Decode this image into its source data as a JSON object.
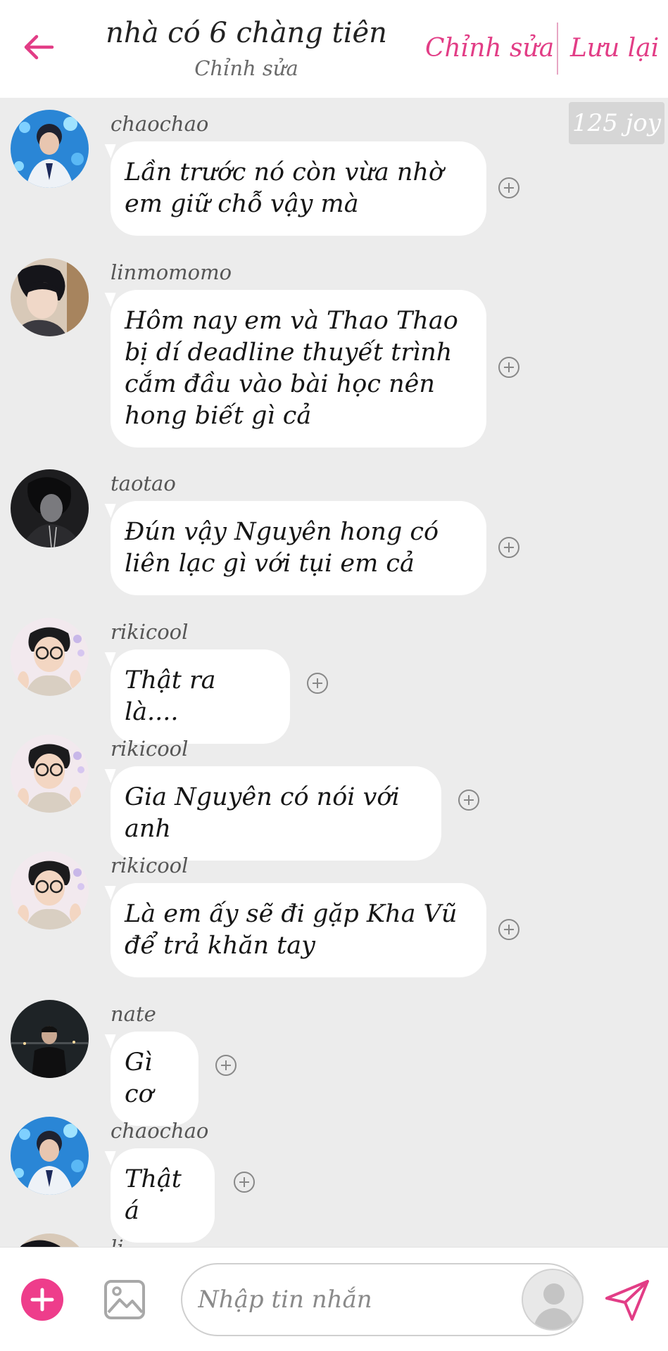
{
  "header": {
    "title": "nhà có 6 chàng tiên",
    "subtitle": "Chỉnh sửa",
    "edit_label": "Chỉnh sửa",
    "save_label": "Lưu lại"
  },
  "badge": {
    "joy": "125 joy"
  },
  "messages": [
    {
      "user": "chaochao",
      "text": "Lần trước nó còn vừa nhờ em giữ chỗ vậy mà",
      "avatar": "chaochao-avatar"
    },
    {
      "user": "linmomomo",
      "text": "Hôm nay em và Thao Thao bị dí deadline thuyết trình cắm đầu vào bài học nên hong biết gì cả",
      "avatar": "linmomomo-avatar"
    },
    {
      "user": "taotao",
      "text": "Đún vậy Nguyên hong có liên lạc gì với tụi em cả",
      "avatar": "taotao-avatar"
    },
    {
      "user": "rikicool",
      "text": "Thật ra là....",
      "avatar": "rikicool-avatar"
    },
    {
      "user": "rikicool",
      "text": "Gia Nguyên có nói với anh",
      "avatar": "rikicool-avatar"
    },
    {
      "user": "rikicool",
      "text": "Là em ấy sẽ đi gặp Kha Vũ để trả khăn tay",
      "avatar": "rikicool-avatar"
    },
    {
      "user": "nate",
      "text": "Gì cơ",
      "avatar": "nate-avatar"
    },
    {
      "user": "chaochao",
      "text": "Thật á",
      "avatar": "chaochao-avatar"
    },
    {
      "user": "li",
      "text": "",
      "avatar": "linmomomo-avatar"
    }
  ],
  "composer": {
    "placeholder": "Nhập tin nhắn",
    "add_icon": "plus-icon",
    "image_icon": "image-icon",
    "profile_icon": "person-icon",
    "send_icon": "send-icon"
  },
  "colors": {
    "accent": "#e23d86",
    "add_button": "#ee3d8b",
    "chat_background": "#ececec",
    "bubble": "#ffffff"
  }
}
